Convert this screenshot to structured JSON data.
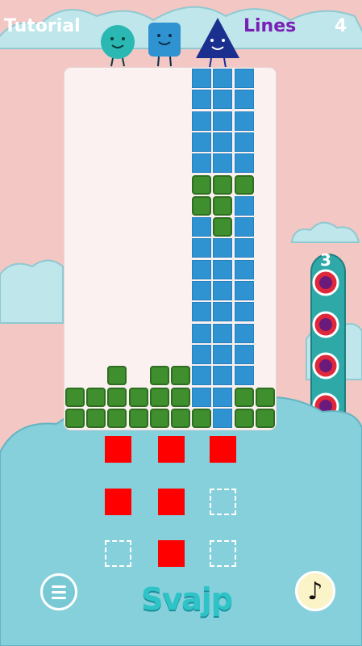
{
  "hud": {
    "tutorial": "Tutorial",
    "lines_label": "Lines",
    "lines_count": "4"
  },
  "tower": {
    "count": "3",
    "ring_count": 4
  },
  "logo": {
    "text": "Svajp"
  },
  "grid": {
    "cols": 10,
    "rows": 17,
    "blue_cols": [
      6,
      7,
      8
    ],
    "cells": [
      [
        "g",
        6,
        5
      ],
      [
        "g",
        7,
        5
      ],
      [
        "g",
        8,
        5
      ],
      [
        "g",
        6,
        6
      ],
      [
        "g",
        7,
        6
      ],
      [
        "g",
        7,
        7
      ],
      [
        "g",
        2,
        14
      ],
      [
        "g",
        4,
        14
      ],
      [
        "g",
        5,
        14
      ],
      [
        "g",
        0,
        15
      ],
      [
        "g",
        1,
        15
      ],
      [
        "g",
        2,
        15
      ],
      [
        "g",
        3,
        15
      ],
      [
        "g",
        4,
        15
      ],
      [
        "g",
        5,
        15
      ],
      [
        "g",
        8,
        15
      ],
      [
        "g",
        9,
        15
      ],
      [
        "g",
        0,
        16
      ],
      [
        "g",
        1,
        16
      ],
      [
        "g",
        2,
        16
      ],
      [
        "g",
        3,
        16
      ],
      [
        "g",
        4,
        16
      ],
      [
        "g",
        5,
        16
      ],
      [
        "g",
        6,
        16
      ],
      [
        "g",
        8,
        16
      ],
      [
        "g",
        9,
        16
      ]
    ]
  },
  "pads": [
    [
      true,
      true,
      true
    ],
    [
      true,
      true,
      false
    ],
    [
      false,
      true,
      false
    ]
  ],
  "colors": {
    "blue": "#2f93d2",
    "green": "#3f8f2e",
    "red": "#ff0000",
    "teal": "#78c9d4",
    "purple": "#7a1fb6"
  }
}
